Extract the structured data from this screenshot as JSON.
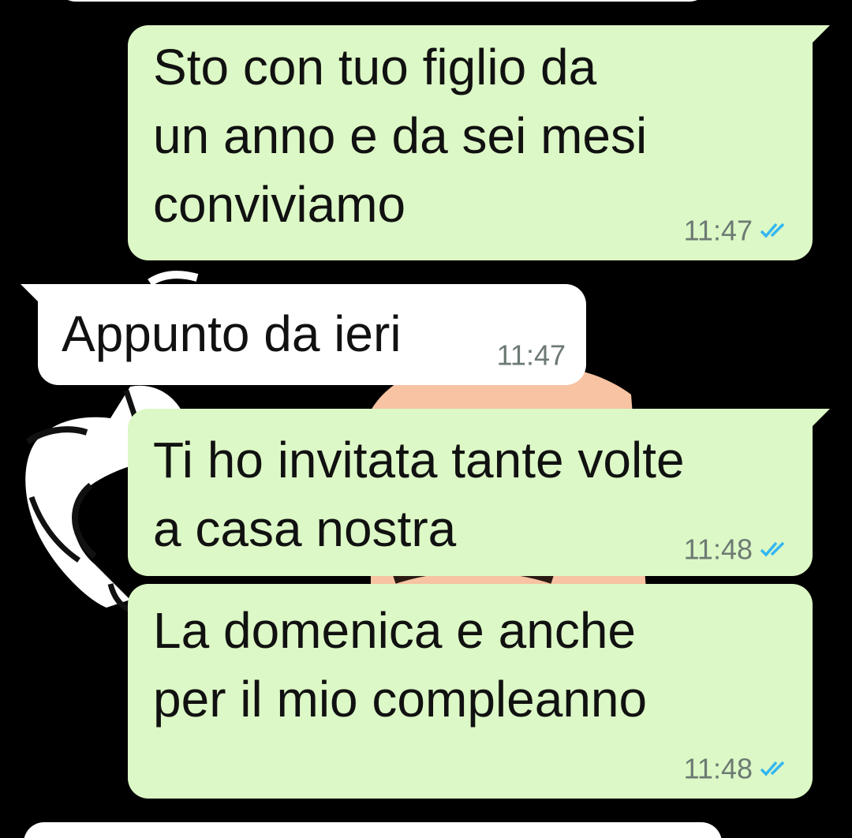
{
  "colors": {
    "background": "#000000",
    "outgoing_bubble": "#dcf8c6",
    "incoming_bubble": "#ffffff",
    "timestamp": "#6d7a73",
    "read_ticks": "#34b7f1"
  },
  "messages": [
    {
      "direction": "outgoing",
      "text": "Sto con tuo figlio da\nun anno e da sei mesi\nconviviamo",
      "time": "11:47",
      "status_icon": "double-check-read-icon"
    },
    {
      "direction": "incoming",
      "text": "Appunto da ieri",
      "time": "11:47"
    },
    {
      "direction": "outgoing",
      "text": "Ti ho invitata tante volte\na casa nostra",
      "time": "11:48",
      "status_icon": "double-check-read-icon"
    },
    {
      "direction": "outgoing",
      "text": "La domenica e anche\nper il mio compleanno",
      "time": "11:48",
      "status_icon": "double-check-read-icon"
    }
  ]
}
